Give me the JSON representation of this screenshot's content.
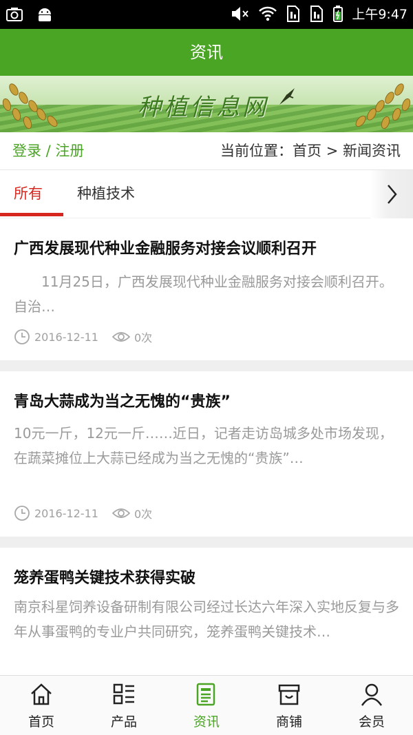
{
  "status_bar": {
    "time": "上午9:47",
    "icons": [
      "camera-icon",
      "android-icon",
      "mute-icon",
      "wifi-icon",
      "sim1-icon",
      "sim2-icon",
      "battery-icon"
    ]
  },
  "header": {
    "title": "资讯"
  },
  "banner": {
    "logo_text": "种植信息网"
  },
  "login_row": {
    "login_label": "登录 / 注册",
    "breadcrumb": "当前位置：首页 > 新闻资讯"
  },
  "tabs": [
    {
      "label": "所有",
      "active": true
    },
    {
      "label": "种植技术",
      "active": false
    }
  ],
  "news": [
    {
      "title": "广西发展现代种业金融服务对接会议顺利召开",
      "summary": "　　11月25日，广西发展现代种业金融服务对接会顺利召开。自治…",
      "date": "2016-12-11",
      "views": "0次"
    },
    {
      "title": "青岛大蒜成为当之无愧的“贵族”",
      "summary": "10元一斤，12元一斤……近日，记者走访岛城多处市场发现，在蔬菜摊位上大蒜已经成为当之无愧的“贵族”…",
      "date": "2016-12-11",
      "views": "0次"
    },
    {
      "title": "笼养蛋鸭关键技术获得实破",
      "summary": "南京科星饲养设备研制有限公司经过长达六年深入实地反复与多年从事蛋鸭的专业户共同研究，笼养蛋鸭关键技术…"
    }
  ],
  "bottom_nav": [
    {
      "label": "首页",
      "icon": "home-icon"
    },
    {
      "label": "产品",
      "icon": "grid-list-icon"
    },
    {
      "label": "资讯",
      "icon": "document-icon",
      "active": true
    },
    {
      "label": "商铺",
      "icon": "shop-icon"
    },
    {
      "label": "会员",
      "icon": "user-icon"
    }
  ],
  "colors": {
    "brand_green": "#4aa524",
    "active_red": "#d6261d"
  }
}
